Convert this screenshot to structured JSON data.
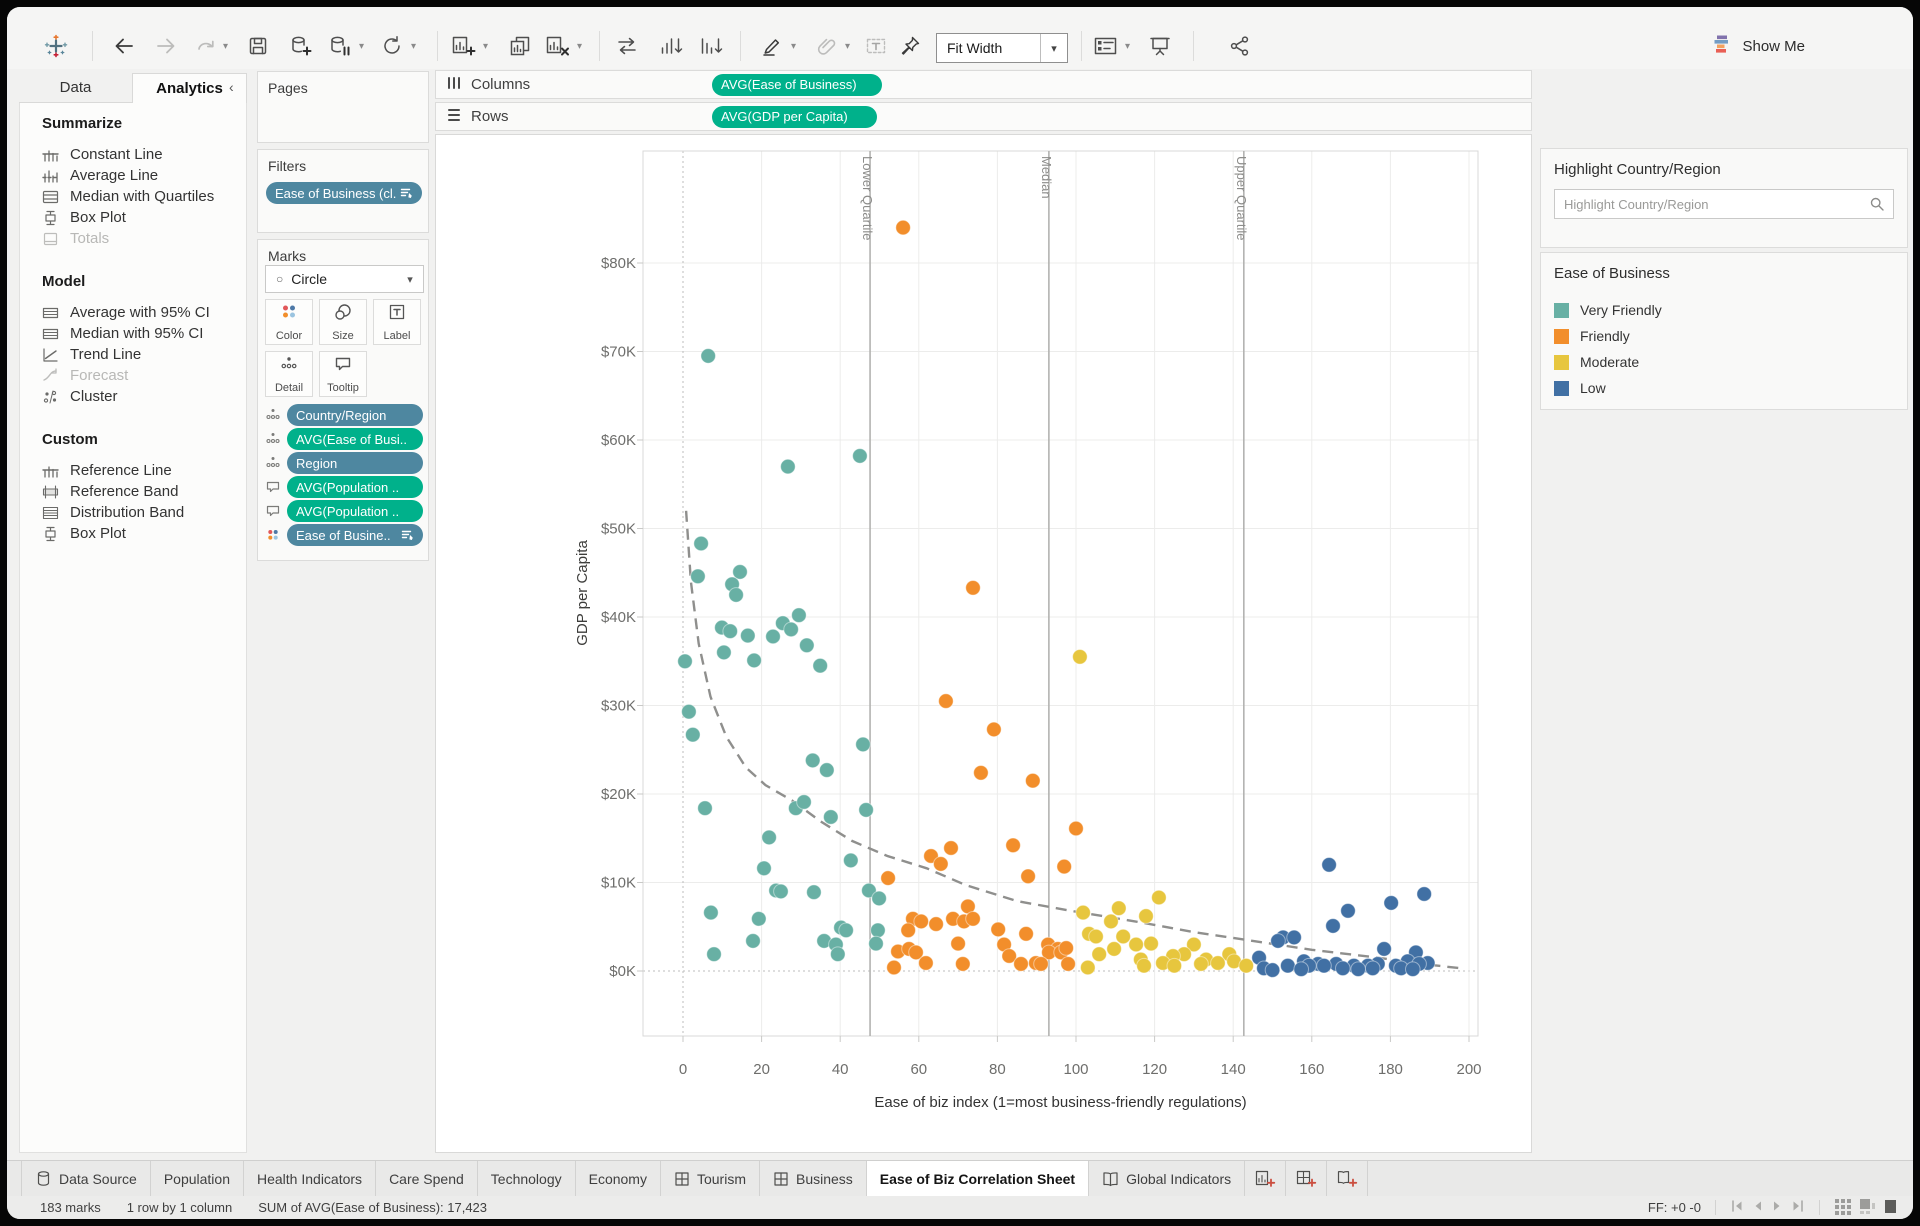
{
  "toolbar": {
    "fit_width": "Fit Width",
    "show_me": "Show Me"
  },
  "sidebar": {
    "tabs": [
      {
        "label": "Data"
      },
      {
        "label": "Analytics"
      }
    ],
    "active_tab": "Analytics",
    "sections": [
      {
        "title": "Summarize",
        "items": [
          {
            "label": "Constant Line",
            "icon": "constant-line",
            "disabled": false
          },
          {
            "label": "Average Line",
            "icon": "average-line",
            "disabled": false
          },
          {
            "label": "Median with Quartiles",
            "icon": "median-quartiles",
            "disabled": false
          },
          {
            "label": "Box Plot",
            "icon": "box-plot",
            "disabled": false
          },
          {
            "label": "Totals",
            "icon": "totals",
            "disabled": true
          }
        ]
      },
      {
        "title": "Model",
        "items": [
          {
            "label": "Average with 95% CI",
            "icon": "band-ci",
            "disabled": false
          },
          {
            "label": "Median with 95% CI",
            "icon": "band-ci",
            "disabled": false
          },
          {
            "label": "Trend Line",
            "icon": "trend-line",
            "disabled": false
          },
          {
            "label": "Forecast",
            "icon": "forecast",
            "disabled": true
          },
          {
            "label": "Cluster",
            "icon": "cluster",
            "disabled": false
          }
        ]
      },
      {
        "title": "Custom",
        "items": [
          {
            "label": "Reference Line",
            "icon": "constant-line",
            "disabled": false
          },
          {
            "label": "Reference Band",
            "icon": "ref-band",
            "disabled": false
          },
          {
            "label": "Distribution Band",
            "icon": "dist-band",
            "disabled": false
          },
          {
            "label": "Box Plot",
            "icon": "box-plot",
            "disabled": false
          }
        ]
      }
    ]
  },
  "cards": {
    "pages": {
      "title": "Pages"
    },
    "filters": {
      "title": "Filters",
      "pills": [
        {
          "label": "Ease of Business (cl..",
          "color": "blue",
          "sorted": true
        }
      ]
    },
    "marks": {
      "title": "Marks",
      "mark_type": "Circle",
      "buttons": [
        {
          "label": "Color",
          "icon": "color"
        },
        {
          "label": "Size",
          "icon": "size"
        },
        {
          "label": "Label",
          "icon": "label"
        },
        {
          "label": "Detail",
          "icon": "detail"
        },
        {
          "label": "Tooltip",
          "icon": "tooltip"
        }
      ],
      "pills": [
        {
          "icon": "detail",
          "label": "Country/Region",
          "color": "blue",
          "sorted": false
        },
        {
          "icon": "detail",
          "label": "AVG(Ease of Busi..",
          "color": "green",
          "sorted": false
        },
        {
          "icon": "detail",
          "label": "Region",
          "color": "blue",
          "sorted": false
        },
        {
          "icon": "tooltip",
          "label": "AVG(Population ..",
          "color": "green",
          "sorted": false
        },
        {
          "icon": "tooltip",
          "label": "AVG(Population ..",
          "color": "green",
          "sorted": false
        },
        {
          "icon": "color",
          "label": "Ease of Busine..",
          "color": "blue",
          "sorted": true
        }
      ]
    }
  },
  "shelves": {
    "columns": {
      "label": "Columns",
      "pill": "AVG(Ease of Business)"
    },
    "rows": {
      "label": "Rows",
      "pill": "AVG(GDP per Capita)"
    }
  },
  "right_panel": {
    "highlight": {
      "title": "Highlight Country/Region",
      "placeholder": "Highlight Country/Region"
    },
    "legend": {
      "title": "Ease of Business",
      "items": [
        {
          "label": "Very Friendly",
          "color": "#68b0a4"
        },
        {
          "label": "Friendly",
          "color": "#f28e2b"
        },
        {
          "label": "Moderate",
          "color": "#e7c63e"
        },
        {
          "label": "Low",
          "color": "#4170a4"
        }
      ]
    }
  },
  "tabs": [
    {
      "label": "Data Source",
      "icon": "database",
      "active": false
    },
    {
      "label": "Population",
      "icon": null,
      "active": false
    },
    {
      "label": "Health Indicators",
      "icon": null,
      "active": false
    },
    {
      "label": "Care Spend",
      "icon": null,
      "active": false
    },
    {
      "label": "Technology",
      "icon": null,
      "active": false
    },
    {
      "label": "Economy",
      "icon": null,
      "active": false
    },
    {
      "label": "Tourism",
      "icon": "grid",
      "active": false
    },
    {
      "label": "Business",
      "icon": "grid",
      "active": false
    },
    {
      "label": "Ease of Biz Correlation Sheet",
      "icon": null,
      "active": true
    },
    {
      "label": "Global Indicators",
      "icon": "book",
      "active": false
    }
  ],
  "status": {
    "left": [
      "183 marks",
      "1 row by 1 column",
      "SUM of AVG(Ease of Business): 17,423"
    ],
    "ff": "FF: +0 -0"
  },
  "chart_data": {
    "type": "scatter",
    "xlabel": "Ease of biz index (1=most business-friendly regulations)",
    "ylabel": "GDP per Capita",
    "x_ticks": [
      0,
      20,
      40,
      60,
      80,
      100,
      120,
      140,
      160,
      180,
      200
    ],
    "y_ticks": [
      0,
      10,
      20,
      30,
      40,
      50,
      60,
      70,
      80
    ],
    "y_tick_format": "$%dK",
    "y_unit": "USD thousands",
    "xlim": [
      -10.2,
      202.3
    ],
    "ylim": [
      -7.3,
      92.7
    ],
    "grid": true,
    "legend_position": "right",
    "reference_lines": [
      {
        "label": "Lower Quartile",
        "x": 47.6
      },
      {
        "label": "Median",
        "x": 93.1
      },
      {
        "label": "Upper Quartile",
        "x": 142.7
      }
    ],
    "trend_dashed": [
      [
        0.8,
        52
      ],
      [
        2,
        44
      ],
      [
        4,
        37
      ],
      [
        7,
        31
      ],
      [
        11,
        26.5
      ],
      [
        16,
        23
      ],
      [
        21,
        21
      ],
      [
        28,
        19.2
      ],
      [
        35,
        16.9
      ],
      [
        43,
        14.7
      ],
      [
        52,
        13
      ],
      [
        62,
        11.6
      ],
      [
        72,
        9.7
      ],
      [
        85,
        7.9
      ],
      [
        100,
        6.7
      ],
      [
        115,
        5.6
      ],
      [
        130,
        4.4
      ],
      [
        145,
        3.4
      ],
      [
        160,
        2.4
      ],
      [
        175,
        1.6
      ],
      [
        190,
        0.7
      ],
      [
        198,
        0.3
      ]
    ],
    "series": [
      {
        "name": "Very Friendly",
        "color": "#68b0a4",
        "points": [
          [
            6.4,
            69.5
          ],
          [
            26.7,
            57
          ],
          [
            45,
            58.2
          ],
          [
            4.6,
            48.3
          ],
          [
            3.8,
            44.6
          ],
          [
            14.5,
            45.1
          ],
          [
            12.5,
            43.7
          ],
          [
            13.5,
            42.5
          ],
          [
            29.5,
            40.2
          ],
          [
            25.4,
            39.3
          ],
          [
            27.5,
            38.6
          ],
          [
            9.9,
            38.8
          ],
          [
            12,
            38.4
          ],
          [
            16.5,
            37.9
          ],
          [
            22.9,
            37.8
          ],
          [
            31.5,
            36.8
          ],
          [
            10.4,
            36
          ],
          [
            18.1,
            35.1
          ],
          [
            0.5,
            35
          ],
          [
            34.9,
            34.5
          ],
          [
            1.5,
            29.3
          ],
          [
            2.5,
            26.7
          ],
          [
            45.8,
            25.6
          ],
          [
            33,
            23.8
          ],
          [
            36.6,
            22.7
          ],
          [
            5.6,
            18.4
          ],
          [
            28.7,
            18.4
          ],
          [
            30.8,
            19.1
          ],
          [
            37.6,
            17.4
          ],
          [
            46.6,
            18.2
          ],
          [
            21.9,
            15.1
          ],
          [
            42.7,
            12.5
          ],
          [
            20.6,
            11.6
          ],
          [
            23.7,
            9.1
          ],
          [
            24.9,
            9
          ],
          [
            33.3,
            8.9
          ],
          [
            47.3,
            9.1
          ],
          [
            49.9,
            8.2
          ],
          [
            7.1,
            6.6
          ],
          [
            19.3,
            5.9
          ],
          [
            40.2,
            4.9
          ],
          [
            41.5,
            4.6
          ],
          [
            49.6,
            4.6
          ],
          [
            35.9,
            3.4
          ],
          [
            38.9,
            3
          ],
          [
            17.8,
            3.4
          ],
          [
            7.9,
            1.9
          ],
          [
            39.4,
            1.9
          ],
          [
            49.1,
            3.1
          ]
        ]
      },
      {
        "name": "Friendly",
        "color": "#f28e2b",
        "points": [
          [
            56,
            84
          ],
          [
            73.8,
            43.3
          ],
          [
            66.9,
            30.5
          ],
          [
            79.1,
            27.3
          ],
          [
            75.8,
            22.4
          ],
          [
            89,
            21.5
          ],
          [
            100,
            16.1
          ],
          [
            68.2,
            13.9
          ],
          [
            84,
            14.2
          ],
          [
            63.1,
            13
          ],
          [
            65.6,
            12.1
          ],
          [
            97,
            11.8
          ],
          [
            87.8,
            10.7
          ],
          [
            52.2,
            10.5
          ],
          [
            72.5,
            7.3
          ],
          [
            58.5,
            5.9
          ],
          [
            60.6,
            5.6
          ],
          [
            64.4,
            5.3
          ],
          [
            68.7,
            5.9
          ],
          [
            71.5,
            5.6
          ],
          [
            73.8,
            5.9
          ],
          [
            57.3,
            4.6
          ],
          [
            80.2,
            4.7
          ],
          [
            87.3,
            4.2
          ],
          [
            70,
            3.1
          ],
          [
            81.7,
            3
          ],
          [
            92.9,
            3
          ],
          [
            54.7,
            2.2
          ],
          [
            57.5,
            2.5
          ],
          [
            59.3,
            2.1
          ],
          [
            95.4,
            2.5
          ],
          [
            93.1,
            2.1
          ],
          [
            96.2,
            2.1
          ],
          [
            97.5,
            2.6
          ],
          [
            83,
            1.7
          ],
          [
            61.8,
            0.9
          ],
          [
            89.8,
            0.9
          ],
          [
            71.2,
            0.8
          ],
          [
            86,
            0.8
          ],
          [
            91.1,
            0.8
          ],
          [
            98,
            0.8
          ],
          [
            53.7,
            0.4
          ]
        ]
      },
      {
        "name": "Moderate",
        "color": "#e7c63e",
        "points": [
          [
            101,
            35.5
          ],
          [
            121.1,
            8.3
          ],
          [
            110.9,
            7.1
          ],
          [
            101.8,
            6.6
          ],
          [
            117.8,
            6.2
          ],
          [
            108.9,
            5.6
          ],
          [
            103.3,
            4.2
          ],
          [
            105.1,
            3.9
          ],
          [
            112,
            3.9
          ],
          [
            115.3,
            3
          ],
          [
            119.1,
            3.1
          ],
          [
            130,
            3
          ],
          [
            109.7,
            2.5
          ],
          [
            105.9,
            1.9
          ],
          [
            127.5,
            1.9
          ],
          [
            139,
            1.9
          ],
          [
            124.7,
            1.7
          ],
          [
            116.5,
            1.3
          ],
          [
            133.1,
            1.3
          ],
          [
            140.2,
            1.1
          ],
          [
            122.1,
            0.9
          ],
          [
            136.1,
            0.9
          ],
          [
            131.8,
            0.8
          ],
          [
            117.3,
            0.6
          ],
          [
            125,
            0.6
          ],
          [
            143.3,
            0.6
          ],
          [
            103,
            0.4
          ]
        ]
      },
      {
        "name": "Low",
        "color": "#4170a4",
        "points": [
          [
            164.4,
            12
          ],
          [
            188.6,
            8.7
          ],
          [
            180.2,
            7.7
          ],
          [
            169.2,
            6.8
          ],
          [
            165.4,
            5.1
          ],
          [
            152.7,
            3.8
          ],
          [
            155.5,
            3.8
          ],
          [
            151.4,
            3.4
          ],
          [
            178.4,
            2.5
          ],
          [
            186.5,
            2.1
          ],
          [
            146.6,
            1.5
          ],
          [
            158,
            1.1
          ],
          [
            184.4,
            1.1
          ],
          [
            189.5,
            0.9
          ],
          [
            161.6,
            0.8
          ],
          [
            166.2,
            0.8
          ],
          [
            176.8,
            0.8
          ],
          [
            187.3,
            0.8
          ],
          [
            153.9,
            0.6
          ],
          [
            159.3,
            0.6
          ],
          [
            163.1,
            0.6
          ],
          [
            170.7,
            0.6
          ],
          [
            174.3,
            0.6
          ],
          [
            181.4,
            0.6
          ],
          [
            167.9,
            0.3
          ],
          [
            175.5,
            0.3
          ],
          [
            182.7,
            0.3
          ],
          [
            147.8,
            0.3
          ],
          [
            157.3,
            0.2
          ],
          [
            171.8,
            0.2
          ],
          [
            185.7,
            0.2
          ],
          [
            150,
            0.1
          ]
        ]
      }
    ]
  }
}
